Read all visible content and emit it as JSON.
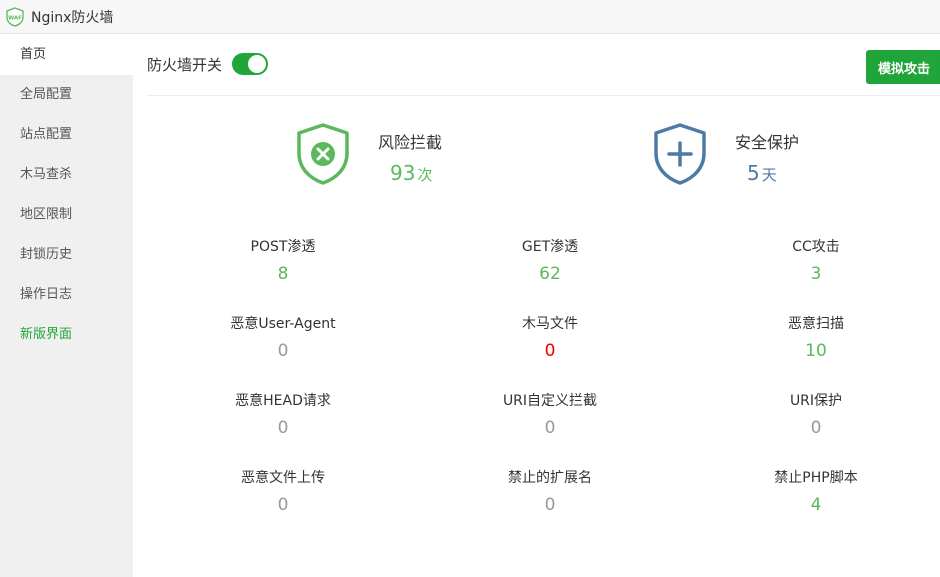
{
  "app": {
    "title": "Nginx防火墙",
    "logo_text": "WAF"
  },
  "sidebar": {
    "items": [
      {
        "label": "首页"
      },
      {
        "label": "全局配置"
      },
      {
        "label": "站点配置"
      },
      {
        "label": "木马查杀"
      },
      {
        "label": "地区限制"
      },
      {
        "label": "封锁历史"
      },
      {
        "label": "操作日志"
      },
      {
        "label": "新版界面"
      }
    ]
  },
  "header": {
    "toggle_label": "防火墙开关",
    "toggle_state": "on",
    "simulate_button": "模拟攻击"
  },
  "summary": {
    "risk": {
      "title": "风险拦截",
      "value": "93",
      "unit": "次",
      "icon": "shield-x-icon"
    },
    "protect": {
      "title": "安全保护",
      "value": "5",
      "unit": "天",
      "icon": "shield-plus-icon"
    }
  },
  "stats": [
    {
      "label": "POST渗透",
      "value": "8"
    },
    {
      "label": "GET渗透",
      "value": "62"
    },
    {
      "label": "CC攻击",
      "value": "3"
    },
    {
      "label": "恶意User-Agent",
      "value": "0"
    },
    {
      "label": "木马文件",
      "value": "0"
    },
    {
      "label": "恶意扫描",
      "value": "10"
    },
    {
      "label": "恶意HEAD请求",
      "value": "0"
    },
    {
      "label": "URI自定义拦截",
      "value": "0"
    },
    {
      "label": "URI保护",
      "value": "0"
    },
    {
      "label": "恶意文件上传",
      "value": "0"
    },
    {
      "label": "禁止的扩展名",
      "value": "0"
    },
    {
      "label": "禁止PHP脚本",
      "value": "4"
    }
  ],
  "colors": {
    "accent": "#20a53a",
    "count_green": "#5cb85c",
    "zero_gray": "#999999",
    "alert_red": "#ee0000",
    "protect_blue": "#4e7aa6"
  }
}
